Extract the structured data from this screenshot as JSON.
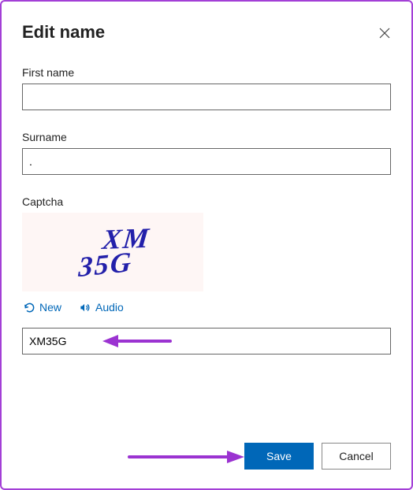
{
  "dialog": {
    "title": "Edit name"
  },
  "fields": {
    "first_name": {
      "label": "First name",
      "value": ""
    },
    "surname": {
      "label": "Surname",
      "value": "."
    },
    "captcha": {
      "label": "Captcha",
      "image_text": "XM35G",
      "links": {
        "new": "New",
        "audio": "Audio"
      },
      "input_value": "XM35G"
    }
  },
  "buttons": {
    "save": "Save",
    "cancel": "Cancel"
  },
  "colors": {
    "accent": "#0067b8",
    "border": "#a33fd6",
    "captcha_ink": "#2320aa",
    "annotation_arrow": "#9b33d1"
  }
}
